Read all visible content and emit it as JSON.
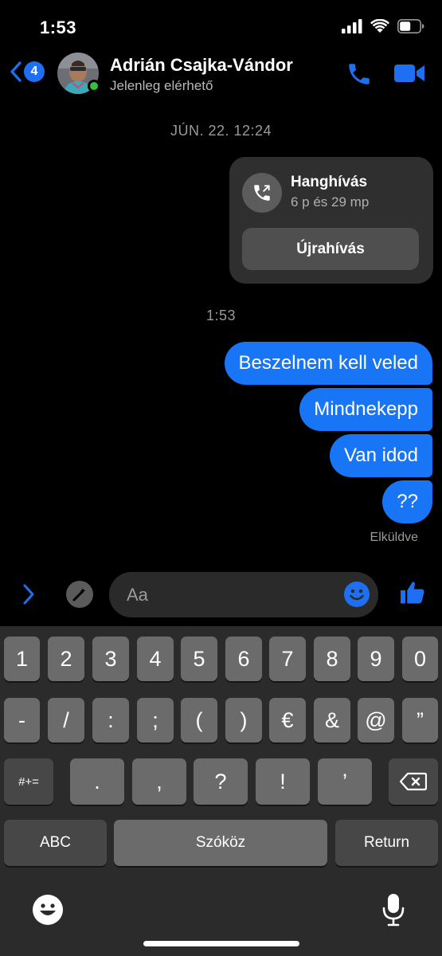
{
  "status_bar": {
    "time": "1:53"
  },
  "header": {
    "back_count": "4",
    "contact_name": "Adrián Csajka-Vándor",
    "contact_status": "Jelenleg elérhető"
  },
  "conversation": {
    "timestamp_top": "JÚN. 22. 12:24",
    "call_card": {
      "title": "Hanghívás",
      "duration": "6 p és 29 mp",
      "redial_label": "Újrahívás"
    },
    "timestamp_mid": "1:53",
    "messages": [
      "Beszelnem kell veled",
      "Mindnekepp",
      "Van idod",
      "??"
    ],
    "sent_status": "Elküldve"
  },
  "composer": {
    "placeholder": "Aa"
  },
  "keyboard": {
    "row1": [
      "1",
      "2",
      "3",
      "4",
      "5",
      "6",
      "7",
      "8",
      "9",
      "0"
    ],
    "row2": [
      "-",
      "/",
      ":",
      ";",
      "(",
      ")",
      "€",
      "&",
      "@",
      "”"
    ],
    "row3": [
      "#+=",
      ".",
      ",",
      "?",
      "!",
      "’"
    ],
    "abc_label": "ABC",
    "space_label": "Szóköz",
    "return_label": "Return"
  },
  "colors": {
    "accent": "#1875f6",
    "online": "#31c23f",
    "background": "#000000"
  }
}
